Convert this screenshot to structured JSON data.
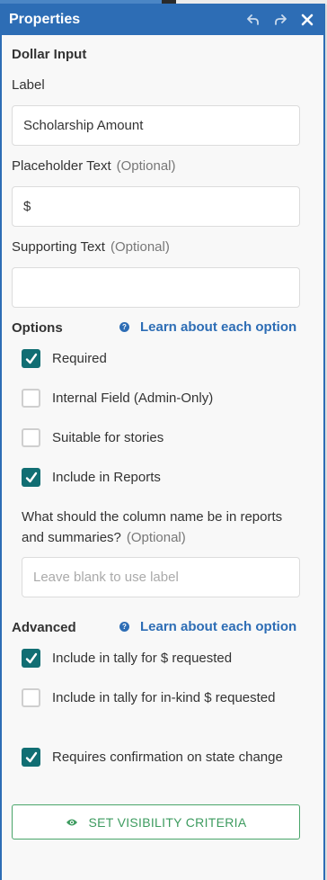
{
  "header": {
    "title": "Properties",
    "undo_icon": "undo-icon",
    "redo_icon": "redo-icon",
    "close_icon": "close-icon"
  },
  "field_type": "Dollar Input",
  "label_field": {
    "label": "Label",
    "value": "Scholarship Amount"
  },
  "placeholder_field": {
    "label": "Placeholder Text",
    "optional": "(Optional)",
    "value": "$"
  },
  "supporting_field": {
    "label": "Supporting Text",
    "optional": "(Optional)",
    "value": ""
  },
  "options": {
    "title": "Options",
    "learn_link": "Learn about each option",
    "required": {
      "label": "Required",
      "checked": true
    },
    "internal": {
      "label": "Internal Field (Admin-Only)",
      "checked": false
    },
    "stories": {
      "label": "Suitable for stories",
      "checked": false
    },
    "reports": {
      "label": "Include in Reports",
      "checked": true
    },
    "column_question": "What should the column name be in reports and summaries?",
    "column_optional": "(Optional)",
    "column_placeholder": "Leave blank to use label"
  },
  "advanced": {
    "title": "Advanced",
    "learn_link": "Learn about each option",
    "tally_requested": {
      "label": "Include in tally for $ requested",
      "checked": true
    },
    "tally_inkind": {
      "label": "Include in tally for in-kind $ requested",
      "checked": false
    },
    "requires_confirmation": {
      "label": "Requires confirmation on state change",
      "checked": true
    }
  },
  "visibility_button": "SET VISIBILITY CRITERIA",
  "colors": {
    "header_bg": "#2d6db5",
    "checkbox_on": "#116e73",
    "link": "#2d6db5",
    "button_green": "#3d9b5f"
  }
}
